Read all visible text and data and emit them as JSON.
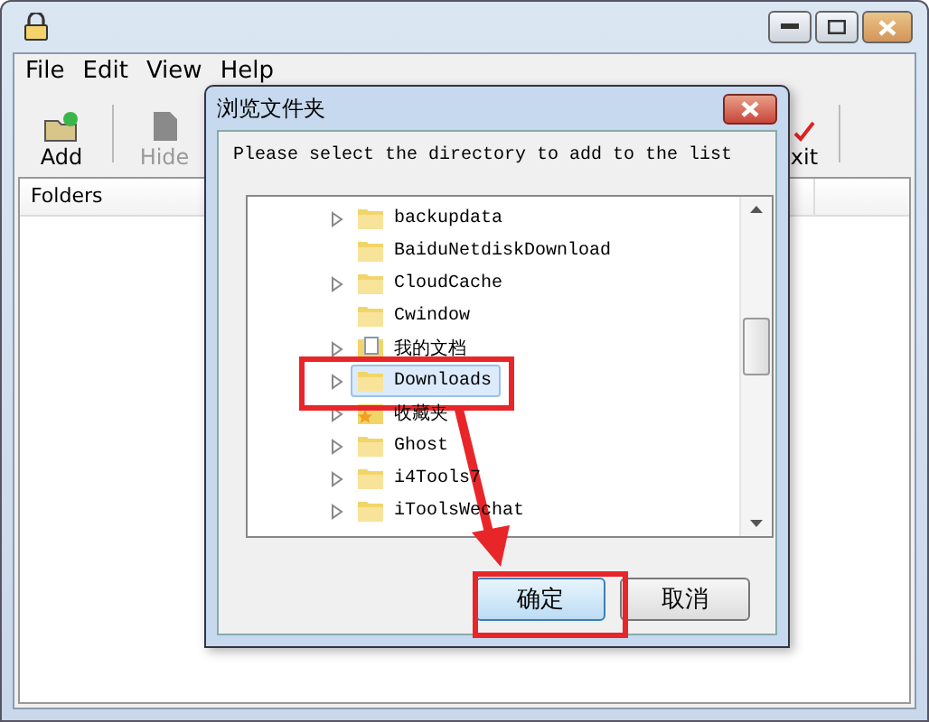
{
  "window": {
    "menu": [
      "File",
      "Edit",
      "View",
      "Help"
    ],
    "toolbar": [
      {
        "label": "Add",
        "kind": "add",
        "disabled": false
      },
      {
        "label": "Hide",
        "kind": "hide",
        "disabled": true
      },
      {
        "label": "xit",
        "kind": "exit",
        "disabled": false
      }
    ],
    "list_header": "Folders"
  },
  "dialog": {
    "title": "浏览文件夹",
    "prompt": "Please select the directory to add to the list",
    "tree": [
      {
        "name": "backupdata",
        "kind": "folder",
        "expandable": true,
        "selected": false
      },
      {
        "name": "BaiduNetdiskDownload",
        "kind": "folder",
        "expandable": false,
        "selected": false
      },
      {
        "name": "CloudCache",
        "kind": "folder",
        "expandable": true,
        "selected": false
      },
      {
        "name": "Cwindow",
        "kind": "folder",
        "expandable": false,
        "selected": false
      },
      {
        "name": "我的文档",
        "kind": "documents",
        "expandable": true,
        "selected": false
      },
      {
        "name": "Downloads",
        "kind": "folder",
        "expandable": true,
        "selected": true
      },
      {
        "name": "收藏夹",
        "kind": "favorites",
        "expandable": true,
        "selected": false
      },
      {
        "name": "Ghost",
        "kind": "folder",
        "expandable": true,
        "selected": false
      },
      {
        "name": "i4Tools7",
        "kind": "folder",
        "expandable": true,
        "selected": false
      },
      {
        "name": "iToolsWechat",
        "kind": "folder",
        "expandable": true,
        "selected": false
      }
    ],
    "buttons": [
      {
        "label": "确定",
        "default": true
      },
      {
        "label": "取消",
        "default": false
      }
    ]
  }
}
